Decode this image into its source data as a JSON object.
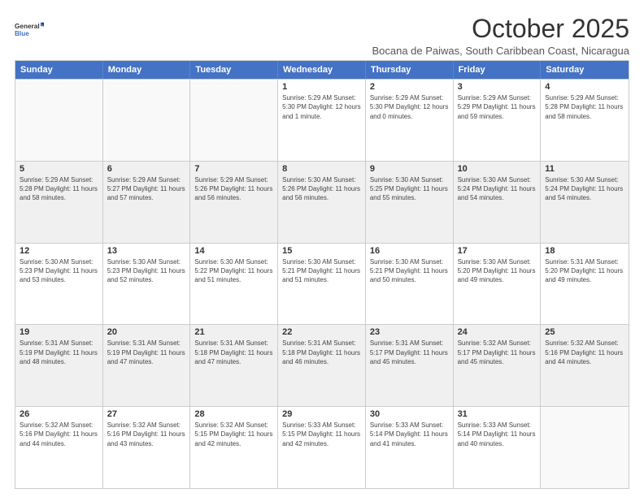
{
  "logo": {
    "line1": "General",
    "line2": "Blue"
  },
  "title": "October 2025",
  "subtitle": "Bocana de Paiwas, South Caribbean Coast, Nicaragua",
  "dayHeaders": [
    "Sunday",
    "Monday",
    "Tuesday",
    "Wednesday",
    "Thursday",
    "Friday",
    "Saturday"
  ],
  "weeks": [
    [
      {
        "day": "",
        "info": ""
      },
      {
        "day": "",
        "info": ""
      },
      {
        "day": "",
        "info": ""
      },
      {
        "day": "1",
        "info": "Sunrise: 5:29 AM\nSunset: 5:30 PM\nDaylight: 12 hours\nand 1 minute."
      },
      {
        "day": "2",
        "info": "Sunrise: 5:29 AM\nSunset: 5:30 PM\nDaylight: 12 hours\nand 0 minutes."
      },
      {
        "day": "3",
        "info": "Sunrise: 5:29 AM\nSunset: 5:29 PM\nDaylight: 11 hours\nand 59 minutes."
      },
      {
        "day": "4",
        "info": "Sunrise: 5:29 AM\nSunset: 5:28 PM\nDaylight: 11 hours\nand 58 minutes."
      }
    ],
    [
      {
        "day": "5",
        "info": "Sunrise: 5:29 AM\nSunset: 5:28 PM\nDaylight: 11 hours\nand 58 minutes."
      },
      {
        "day": "6",
        "info": "Sunrise: 5:29 AM\nSunset: 5:27 PM\nDaylight: 11 hours\nand 57 minutes."
      },
      {
        "day": "7",
        "info": "Sunrise: 5:29 AM\nSunset: 5:26 PM\nDaylight: 11 hours\nand 56 minutes."
      },
      {
        "day": "8",
        "info": "Sunrise: 5:30 AM\nSunset: 5:26 PM\nDaylight: 11 hours\nand 56 minutes."
      },
      {
        "day": "9",
        "info": "Sunrise: 5:30 AM\nSunset: 5:25 PM\nDaylight: 11 hours\nand 55 minutes."
      },
      {
        "day": "10",
        "info": "Sunrise: 5:30 AM\nSunset: 5:24 PM\nDaylight: 11 hours\nand 54 minutes."
      },
      {
        "day": "11",
        "info": "Sunrise: 5:30 AM\nSunset: 5:24 PM\nDaylight: 11 hours\nand 54 minutes."
      }
    ],
    [
      {
        "day": "12",
        "info": "Sunrise: 5:30 AM\nSunset: 5:23 PM\nDaylight: 11 hours\nand 53 minutes."
      },
      {
        "day": "13",
        "info": "Sunrise: 5:30 AM\nSunset: 5:23 PM\nDaylight: 11 hours\nand 52 minutes."
      },
      {
        "day": "14",
        "info": "Sunrise: 5:30 AM\nSunset: 5:22 PM\nDaylight: 11 hours\nand 51 minutes."
      },
      {
        "day": "15",
        "info": "Sunrise: 5:30 AM\nSunset: 5:21 PM\nDaylight: 11 hours\nand 51 minutes."
      },
      {
        "day": "16",
        "info": "Sunrise: 5:30 AM\nSunset: 5:21 PM\nDaylight: 11 hours\nand 50 minutes."
      },
      {
        "day": "17",
        "info": "Sunrise: 5:30 AM\nSunset: 5:20 PM\nDaylight: 11 hours\nand 49 minutes."
      },
      {
        "day": "18",
        "info": "Sunrise: 5:31 AM\nSunset: 5:20 PM\nDaylight: 11 hours\nand 49 minutes."
      }
    ],
    [
      {
        "day": "19",
        "info": "Sunrise: 5:31 AM\nSunset: 5:19 PM\nDaylight: 11 hours\nand 48 minutes."
      },
      {
        "day": "20",
        "info": "Sunrise: 5:31 AM\nSunset: 5:19 PM\nDaylight: 11 hours\nand 47 minutes."
      },
      {
        "day": "21",
        "info": "Sunrise: 5:31 AM\nSunset: 5:18 PM\nDaylight: 11 hours\nand 47 minutes."
      },
      {
        "day": "22",
        "info": "Sunrise: 5:31 AM\nSunset: 5:18 PM\nDaylight: 11 hours\nand 46 minutes."
      },
      {
        "day": "23",
        "info": "Sunrise: 5:31 AM\nSunset: 5:17 PM\nDaylight: 11 hours\nand 45 minutes."
      },
      {
        "day": "24",
        "info": "Sunrise: 5:32 AM\nSunset: 5:17 PM\nDaylight: 11 hours\nand 45 minutes."
      },
      {
        "day": "25",
        "info": "Sunrise: 5:32 AM\nSunset: 5:16 PM\nDaylight: 11 hours\nand 44 minutes."
      }
    ],
    [
      {
        "day": "26",
        "info": "Sunrise: 5:32 AM\nSunset: 5:16 PM\nDaylight: 11 hours\nand 44 minutes."
      },
      {
        "day": "27",
        "info": "Sunrise: 5:32 AM\nSunset: 5:16 PM\nDaylight: 11 hours\nand 43 minutes."
      },
      {
        "day": "28",
        "info": "Sunrise: 5:32 AM\nSunset: 5:15 PM\nDaylight: 11 hours\nand 42 minutes."
      },
      {
        "day": "29",
        "info": "Sunrise: 5:33 AM\nSunset: 5:15 PM\nDaylight: 11 hours\nand 42 minutes."
      },
      {
        "day": "30",
        "info": "Sunrise: 5:33 AM\nSunset: 5:14 PM\nDaylight: 11 hours\nand 41 minutes."
      },
      {
        "day": "31",
        "info": "Sunrise: 5:33 AM\nSunset: 5:14 PM\nDaylight: 11 hours\nand 40 minutes."
      },
      {
        "day": "",
        "info": ""
      }
    ]
  ]
}
